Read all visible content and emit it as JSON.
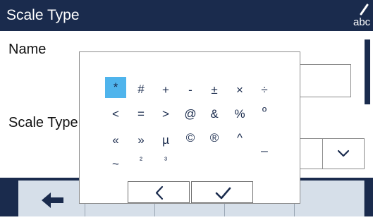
{
  "header": {
    "title": "Scale Type",
    "keyboard_icon_label": "abc"
  },
  "form": {
    "name_label": "Name",
    "scale_type_label": "Scale Type",
    "name_value": "",
    "scale_type_value": ""
  },
  "symbol_picker": {
    "selected": "*",
    "symbols": [
      "*",
      "#",
      "+",
      "-",
      "±",
      "×",
      "÷",
      "<",
      "=",
      ">",
      "@",
      "&",
      "%",
      "º",
      "«",
      "»",
      "µ",
      "©",
      "®",
      "^",
      "_",
      "~",
      "²",
      "³"
    ]
  },
  "icons": {
    "keyboard": "pencil-abc-icon",
    "dropdown": "chevron-down-icon",
    "back": "arrow-left-icon",
    "cancel": "chevron-left-icon",
    "confirm": "checkmark-icon"
  },
  "colors": {
    "header_bg": "#1a2b4d",
    "selected_symbol": "#4fb4ec",
    "toolbar_button": "#d6dfe9"
  }
}
